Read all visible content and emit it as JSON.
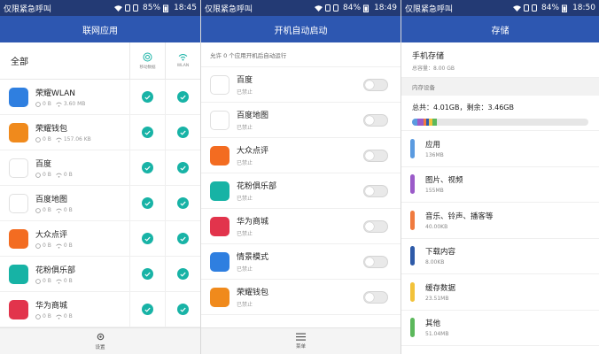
{
  "panels": [
    {
      "status": {
        "carrier": "仅限紧急呼叫",
        "battery": "85%",
        "time": "18:45"
      },
      "title": "联网应用",
      "all_label": "全部",
      "col_mobile_label": "移动数据",
      "col_wlan_label": "WLAN",
      "apps": [
        {
          "name": "荣耀WLAN",
          "mobile": "0 B",
          "wifi": "3.60 MB",
          "icon_bg": "#2f7fe0",
          "icon_glyph": "≋"
        },
        {
          "name": "荣耀钱包",
          "mobile": "0 B",
          "wifi": "157.06 KB",
          "icon_bg": "#f08a1c",
          "icon_glyph": "▬"
        },
        {
          "name": "百度",
          "mobile": "0 B",
          "wifi": "0 B",
          "icon_bg": "#ffffff",
          "icon_glyph": "du"
        },
        {
          "name": "百度地图",
          "mobile": "0 B",
          "wifi": "0 B",
          "icon_bg": "#ffffff",
          "icon_glyph": "du"
        },
        {
          "name": "大众点评",
          "mobile": "0 B",
          "wifi": "0 B",
          "icon_bg": "#f36c21",
          "icon_glyph": "☺"
        },
        {
          "name": "花粉俱乐部",
          "mobile": "0 B",
          "wifi": "0 B",
          "icon_bg": "#17b3a5",
          "icon_glyph": "✿"
        },
        {
          "name": "华为商城",
          "mobile": "0 B",
          "wifi": "0 B",
          "icon_bg": "#e2344c",
          "icon_glyph": "▣"
        }
      ],
      "bottom_label": "设置"
    },
    {
      "status": {
        "carrier": "仅限紧急呼叫",
        "battery": "84%",
        "time": "18:49"
      },
      "title": "开机自动启动",
      "note": "允许 0 个应用开机后自动运行",
      "apps": [
        {
          "name": "百度",
          "status": "已禁止",
          "icon_bg": "#ffffff",
          "icon_glyph": "du"
        },
        {
          "name": "百度地图",
          "status": "已禁止",
          "icon_bg": "#ffffff",
          "icon_glyph": "du"
        },
        {
          "name": "大众点评",
          "status": "已禁止",
          "icon_bg": "#f36c21",
          "icon_glyph": "☺"
        },
        {
          "name": "花粉俱乐部",
          "status": "已禁止",
          "icon_bg": "#17b3a5",
          "icon_glyph": "✿"
        },
        {
          "name": "华为商城",
          "status": "已禁止",
          "icon_bg": "#e2344c",
          "icon_glyph": "▣"
        },
        {
          "name": "情景模式",
          "status": "已禁止",
          "icon_bg": "#2f7fe0",
          "icon_glyph": "◉"
        },
        {
          "name": "荣耀钱包",
          "status": "已禁止",
          "icon_bg": "#f08a1c",
          "icon_glyph": "▬"
        }
      ],
      "bottom_label": "菜单"
    },
    {
      "status": {
        "carrier": "仅限紧急呼叫",
        "battery": "84%",
        "time": "18:50"
      },
      "title": "存储",
      "phone_storage_title": "手机存储",
      "phone_storage_total": "总容量：8.00 GB",
      "section_label": "内存设备",
      "summary": "总共：4.01GB，剩余：3.46GB",
      "categories": [
        {
          "name": "应用",
          "size": "136MB",
          "color": "#5b9be0"
        },
        {
          "name": "图片、视频",
          "size": "155MB",
          "color": "#9b5bc9"
        },
        {
          "name": "音乐、铃声、播客等",
          "size": "40.00KB",
          "color": "#f07b3f"
        },
        {
          "name": "下载内容",
          "size": "8.00KB",
          "color": "#2e5aa8"
        },
        {
          "name": "缓存数据",
          "size": "23.51MB",
          "color": "#f2c23a"
        },
        {
          "name": "其他",
          "size": "51.04MB",
          "color": "#5cb85c"
        }
      ]
    }
  ],
  "colors": {
    "status_bar": "#233a74",
    "title_bar": "#2d57b1",
    "accent_check": "#18b3a6"
  }
}
